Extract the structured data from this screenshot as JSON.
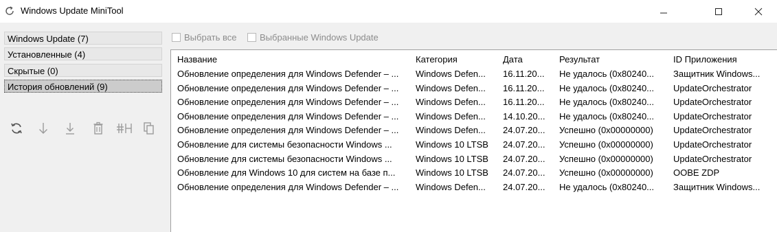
{
  "window": {
    "title": "Windows Update MiniTool",
    "icon": "refresh-icon",
    "controls": [
      "minimize-icon",
      "maximize-icon",
      "close-icon"
    ]
  },
  "sidebar": {
    "items": [
      {
        "label": "Windows Update (7)",
        "selected": false
      },
      {
        "label": "Установленные (4)",
        "selected": false
      },
      {
        "label": "Скрытые (0)",
        "selected": false
      },
      {
        "label": "История обновлений (9)",
        "selected": true
      }
    ]
  },
  "toolbar": {
    "icons": [
      "refresh-icon",
      "download-arrow-icon",
      "install-icon",
      "delete-icon",
      "hide-icon",
      "copy-icon"
    ]
  },
  "options": {
    "select_all": "Выбрать все",
    "selected_updates": "Выбранные Windows Update"
  },
  "table": {
    "columns": [
      "Название",
      "Категория",
      "Дата",
      "Результат",
      "ID Приложения"
    ],
    "rows": [
      [
        "Обновление определения для Windows Defender – ...",
        "Windows Defen...",
        "16.11.20...",
        "Не удалось (0x80240...",
        "Защитник Windows..."
      ],
      [
        "Обновление определения для Windows Defender – ...",
        "Windows Defen...",
        "16.11.20...",
        "Не удалось (0x80240...",
        "UpdateOrchestrator"
      ],
      [
        "Обновление определения для Windows Defender – ...",
        "Windows Defen...",
        "16.11.20...",
        "Не удалось (0x80240...",
        "UpdateOrchestrator"
      ],
      [
        "Обновление определения для Windows Defender – ...",
        "Windows Defen...",
        "14.10.20...",
        "Не удалось (0x80240...",
        "UpdateOrchestrator"
      ],
      [
        "Обновление определения для Windows Defender – ...",
        "Windows Defen...",
        "24.07.20...",
        "Успешно (0x00000000)",
        "UpdateOrchestrator"
      ],
      [
        "Обновление для системы безопасности Windows ...",
        "Windows 10 LTSB",
        "24.07.20...",
        "Успешно (0x00000000)",
        "UpdateOrchestrator"
      ],
      [
        "Обновление для системы безопасности Windows ...",
        "Windows 10 LTSB",
        "24.07.20...",
        "Успешно (0x00000000)",
        "UpdateOrchestrator"
      ],
      [
        "Обновление для Windows 10 для систем на базе п...",
        "Windows 10 LTSB",
        "24.07.20...",
        "Успешно (0x00000000)",
        "OOBE ZDP"
      ],
      [
        "Обновление определения для Windows Defender – ...",
        "Windows Defen...",
        "24.07.20...",
        "Не удалось (0x80240...",
        "Защитник Windows..."
      ]
    ]
  },
  "colors": {
    "window_bg": "#f0f0f0",
    "list_bg": "#ffffff",
    "icon_gray": "#9a9a9a",
    "icon_dark": "#555555"
  }
}
